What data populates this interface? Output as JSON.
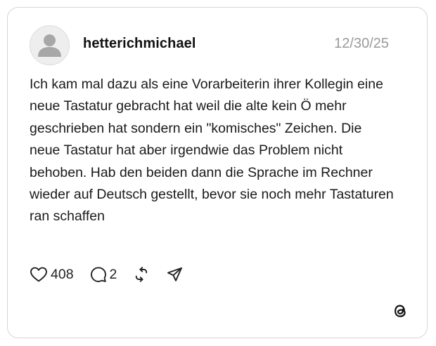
{
  "post": {
    "username": "hetterichmichael",
    "date": "12/30/25",
    "text": "Ich kam mal dazu als eine Vorarbeiterin ihrer Kollegin eine neue Tastatur gebracht hat weil die alte kein Ö mehr geschrieben hat sondern ein \"komisches\" Zeichen. Die neue Tastatur hat aber irgendwie das Problem nicht behoben. Hab den beiden dann die Sprache im Rechner wieder auf Deutsch gestellt, bevor sie noch mehr Tastaturen ran schaffen",
    "likes": "408",
    "replies": "2"
  },
  "icons": {
    "avatar": "default-user-icon",
    "like": "heart-icon",
    "reply": "speech-bubble-icon",
    "repost": "repost-icon",
    "share": "paper-plane-icon",
    "brand": "threads-logo-icon"
  },
  "colors": {
    "border": "#d6d6d6",
    "text": "#111111",
    "muted": "#9a9a9a",
    "avatar_bg": "#eeeeee",
    "avatar_fg": "#a7a7a7"
  }
}
